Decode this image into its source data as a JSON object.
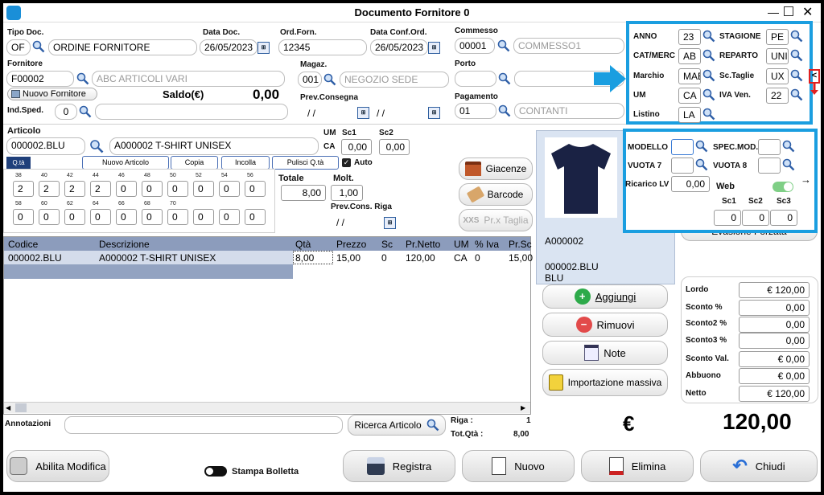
{
  "window": {
    "title": "Documento Fornitore 0"
  },
  "header": {
    "tipo_doc_label": "Tipo Doc.",
    "tipo_doc_code": "OF",
    "tipo_doc_desc": "ORDINE FORNITORE",
    "data_doc_label": "Data Doc.",
    "data_doc_value": "26/05/2023",
    "ord_forn_label": "Ord.Forn.",
    "ord_forn_value": "12345",
    "data_conf_label": "Data Conf.Ord.",
    "data_conf_value": "26/05/2023",
    "commesso_label": "Commesso",
    "commesso_code": "00001",
    "commesso_desc": "COMMESSO1",
    "fornitore_label": "Fornitore",
    "fornitore_code": "F00002",
    "fornitore_desc": "ABC ARTICOLI VARI",
    "nuovo_fornitore_label": "Nuovo Fornitore",
    "saldo_label": "Saldo(€)",
    "saldo_value": "0,00",
    "magaz_label": "Magaz.",
    "magaz_code": "001",
    "magaz_desc": "NEGOZIO SEDE",
    "porto_label": "Porto",
    "ind_sped_label": "Ind.Sped.",
    "ind_sped_value": "0",
    "prev_consegna_label": "Prev.Consegna",
    "prev_consegna_value1": "/ /",
    "prev_consegna_value2": "/ /",
    "pagamento_label": "Pagamento",
    "pagamento_code": "01",
    "pagamento_desc": "CONTANTI",
    "cal_icon": "calendar-icon"
  },
  "filters": {
    "anno_label": "ANNO",
    "anno_value": "23",
    "catmerc_label": "CAT/MERC",
    "catmerc_value": "AB",
    "marchio_label": "Marchio",
    "marchio_value": "MAE",
    "um_label": "UM",
    "um_value": "CA",
    "listino_label": "Listino",
    "listino_value": "LA",
    "stagione_label": "STAGIONE",
    "stagione_value": "PE",
    "reparto_label": "REPARTO",
    "reparto_value": "UNI",
    "sctaglie_label": "Sc.Taglie",
    "sctaglie_value": "UX",
    "iva_label": "IVA Ven.",
    "iva_value": "22"
  },
  "article": {
    "label": "Articolo",
    "code": "000002.BLU",
    "desc": "A000002 T-SHIRT UNISEX",
    "um_label": "UM",
    "um_value": "CA",
    "sc1_label": "Sc1",
    "sc1_value": "0,00",
    "sc2_label": "Sc2",
    "sc2_value": "0,00",
    "qta_tab": "Q.tà",
    "buttons": [
      "Nuovo Articolo",
      "Copia",
      "Incolla",
      "Pulisci Q.tà"
    ],
    "auto_label": "Auto",
    "sizes_row1": [
      "38",
      "40",
      "42",
      "44",
      "46",
      "48",
      "50",
      "52",
      "54",
      "56"
    ],
    "qty_row1": [
      "2",
      "2",
      "2",
      "2",
      "0",
      "0",
      "0",
      "0",
      "0",
      "0"
    ],
    "sizes_row2": [
      "58",
      "60",
      "62",
      "64",
      "66",
      "68",
      "70",
      "",
      "",
      ""
    ],
    "qty_row2": [
      "0",
      "0",
      "0",
      "0",
      "0",
      "0",
      "0",
      "0",
      "0",
      "0"
    ],
    "totale_label": "Totale",
    "totale_value": "8,00",
    "molt_label": "Molt.",
    "molt_value": "1,00",
    "prev_cons_riga_label": "Prev.Cons. Riga",
    "prev_cons_riga_value": "/ /"
  },
  "side_buttons": {
    "giacenze": "Giacenze",
    "barcode": "Barcode",
    "prx_taglia": "Pr.x Taglia",
    "xxs": "XXS"
  },
  "model_panel": {
    "modello_label": "MODELLO",
    "spec_mod_label": "SPEC.MOD.",
    "vuota7_label": "VUOTA 7",
    "vuota8_label": "VUOTA 8",
    "ricarico_label": "Ricarico LV",
    "ricarico_value": "0,00",
    "web_label": "Web",
    "sc1_label": "Sc1",
    "sc2_label": "Sc2",
    "sc3_label": "Sc3",
    "sc1_value": "0",
    "sc2_value": "0",
    "sc3_value": "0"
  },
  "preview": {
    "code": "A000002",
    "variant": "000002.BLU",
    "color": "BLU"
  },
  "evasione_label": "Evasione Forzata",
  "table": {
    "headers": [
      "Codice",
      "Descrizione",
      "Qtà",
      "Prezzo",
      "Sc",
      "Pr.Netto",
      "UM",
      "% Iva",
      "Pr.Sc"
    ],
    "row": [
      "000002.BLU",
      "A000002 T-SHIRT UNISEX",
      "8,00",
      "15,00",
      "0",
      "120,00",
      "CA",
      "0",
      "15,00"
    ]
  },
  "actions": {
    "aggiungi": "Aggiungi",
    "rimuovi": "Rimuovi",
    "note": "Note",
    "importazione": "Importazione massiva"
  },
  "totals": {
    "lordo_label": "Lordo",
    "lordo_value": "€ 120,00",
    "sconto_label": "Sconto %",
    "sconto_value": "0,00",
    "sconto2_label": "Sconto2 %",
    "sconto2_value": "0,00",
    "sconto3_label": "Sconto3 %",
    "sconto3_value": "0,00",
    "sconto_val_label": "Sconto Val.",
    "sconto_val_value": "€ 0,00",
    "abbuono_label": "Abbuono",
    "abbuono_value": "€ 0,00",
    "netto_label": "Netto",
    "netto_value": "€ 120,00"
  },
  "footer_info": {
    "annotazioni_label": "Annotazioni",
    "ricerca_label": "Ricerca Articolo",
    "riga_label": "Riga :",
    "riga_value": "1",
    "totqta_label": "Tot.Qtà :",
    "totqta_value": "8,00",
    "currency": "€",
    "total": "120,00"
  },
  "bottom_bar": {
    "abilita": "Abilita Modifica",
    "stampa": "Stampa Bolletta",
    "registra": "Registra",
    "nuovo": "Nuovo",
    "elimina": "Elimina",
    "chiudi": "Chiudi"
  },
  "colors": {
    "highlight": "#1a9ee0",
    "table_header": "#8c9cbc",
    "accent_red": "#e02020",
    "add_green": "#2daa4a",
    "remove_red": "#e24a4a"
  }
}
